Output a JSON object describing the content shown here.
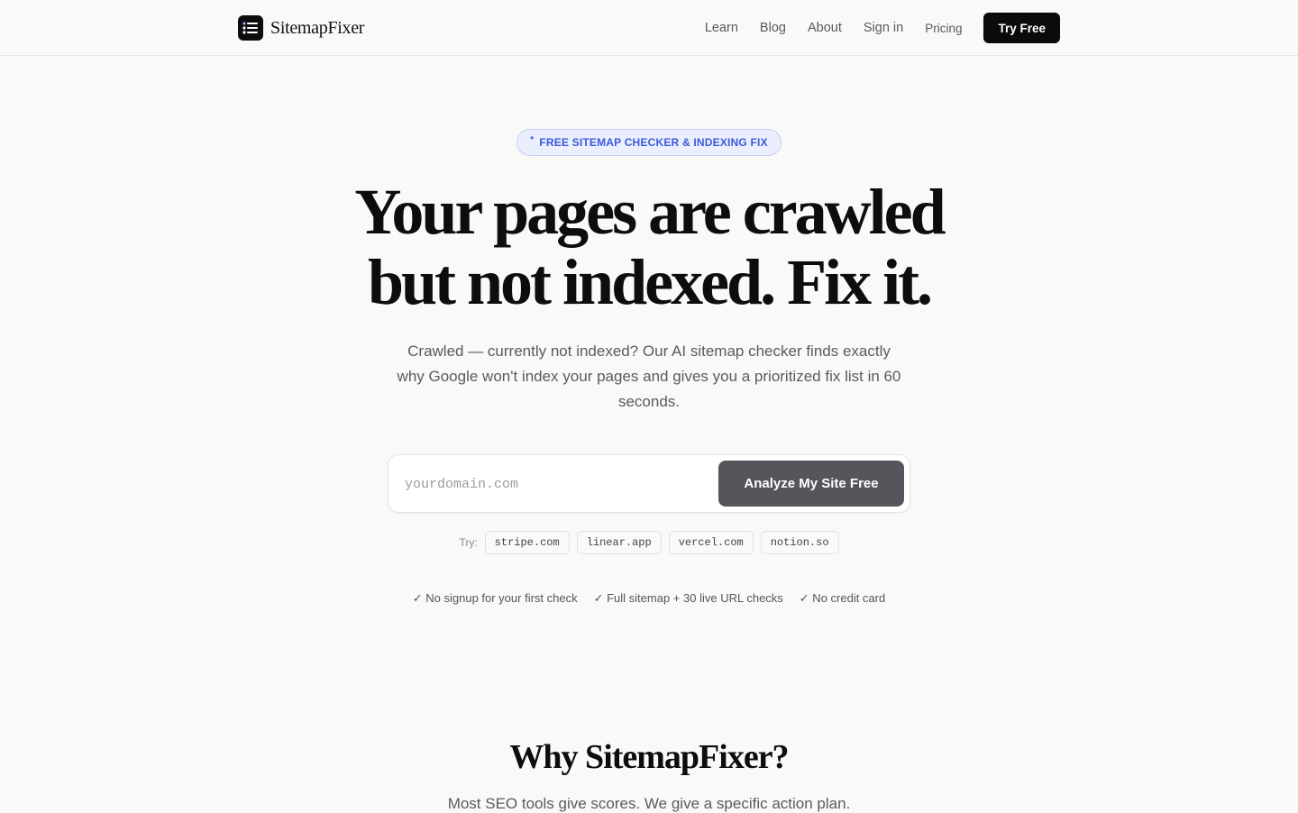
{
  "brand": {
    "name": "SitemapFixer"
  },
  "nav": {
    "links": [
      "Learn",
      "Blog",
      "About",
      "Sign in",
      "Pricing"
    ],
    "cta": "Try Free"
  },
  "hero": {
    "badge_star": "*",
    "badge": "FREE SITEMAP CHECKER & INDEXING FIX",
    "headline_line1": "Your pages are crawled",
    "headline_line2": "but not indexed. Fix it.",
    "subtitle": "Crawled — currently not indexed? Our AI sitemap checker finds exactly why Google won't index your pages and gives you a prioritized fix list in 60 seconds."
  },
  "search": {
    "placeholder": "yourdomain.com",
    "button": "Analyze My Site Free"
  },
  "examples": {
    "label": "Try:",
    "domains": [
      "stripe.com",
      "linear.app",
      "vercel.com",
      "notion.so"
    ]
  },
  "checks": [
    "✓ No signup for your first check",
    "✓ Full sitemap + 30 live URL checks",
    "✓ No credit card"
  ],
  "why": {
    "title": "Why SitemapFixer?",
    "subtitle": "Most SEO tools give scores. We give a specific action plan."
  },
  "colors": {
    "accent_blue": "#3b5bdb",
    "dark": "#0b0b0e",
    "button_gray": "#55555c"
  }
}
